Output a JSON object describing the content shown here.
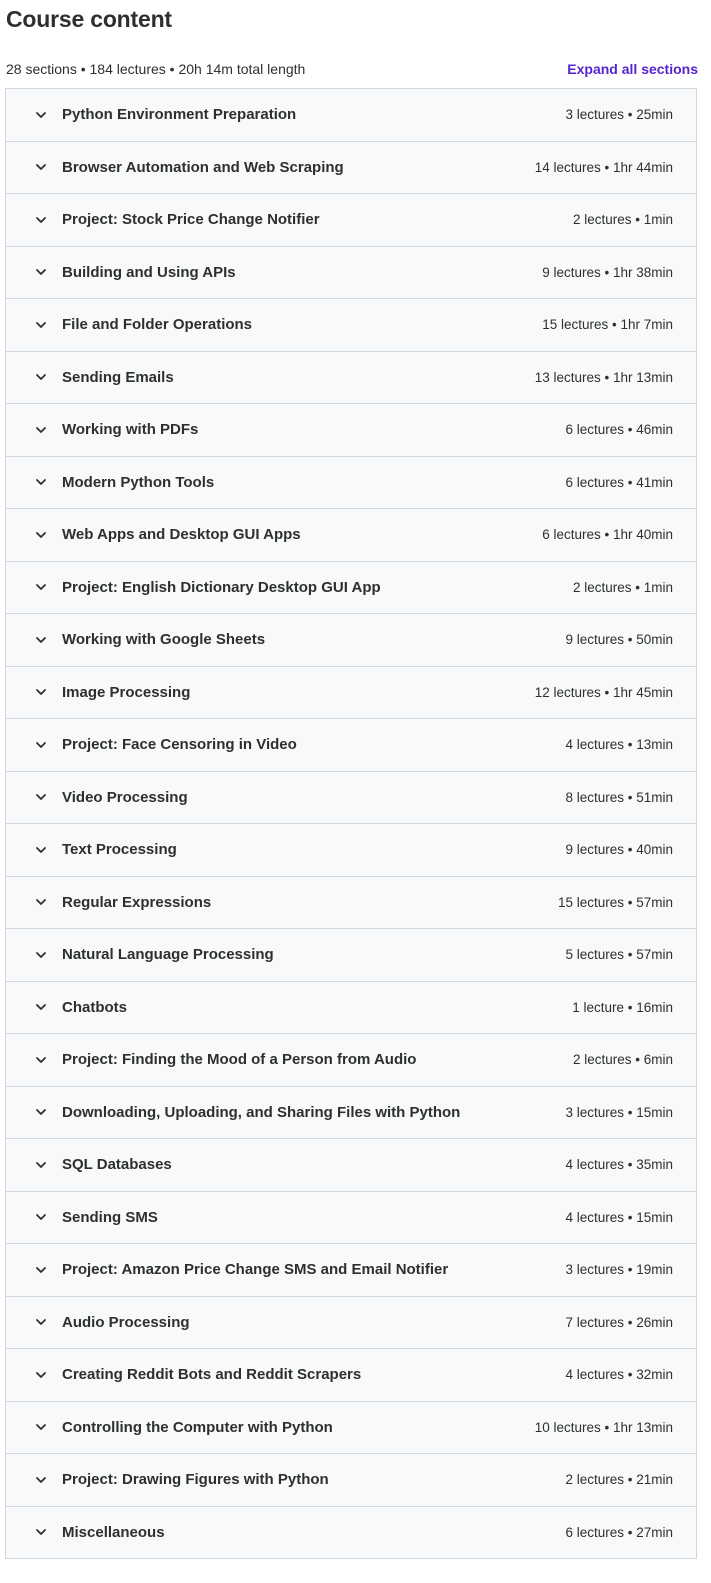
{
  "header": {
    "title": "Course content",
    "summary": "28 sections • 184 lectures • 20h 14m total length",
    "expand_label": "Expand all sections"
  },
  "icons": {
    "section_toggle": "chevron-down-icon"
  },
  "colors": {
    "accent": "#5624d0",
    "section_bg": "#f7f9fa",
    "border": "#d1d7dc",
    "text": "#2d2f31"
  },
  "sections": [
    {
      "title": "Python Environment Preparation",
      "meta": "3 lectures • 25min"
    },
    {
      "title": "Browser Automation and Web Scraping",
      "meta": "14 lectures • 1hr 44min"
    },
    {
      "title": "Project: Stock Price Change Notifier",
      "meta": "2 lectures • 1min"
    },
    {
      "title": "Building and Using APIs",
      "meta": "9 lectures • 1hr 38min"
    },
    {
      "title": "File and Folder Operations",
      "meta": "15 lectures • 1hr 7min"
    },
    {
      "title": "Sending Emails",
      "meta": "13 lectures • 1hr 13min"
    },
    {
      "title": "Working with PDFs",
      "meta": "6 lectures • 46min"
    },
    {
      "title": "Modern Python Tools",
      "meta": "6 lectures • 41min"
    },
    {
      "title": "Web Apps and Desktop GUI Apps",
      "meta": "6 lectures • 1hr 40min"
    },
    {
      "title": "Project: English Dictionary Desktop GUI App",
      "meta": "2 lectures • 1min"
    },
    {
      "title": "Working with Google Sheets",
      "meta": "9 lectures • 50min"
    },
    {
      "title": "Image Processing",
      "meta": "12 lectures • 1hr 45min"
    },
    {
      "title": "Project: Face Censoring in Video",
      "meta": "4 lectures • 13min"
    },
    {
      "title": "Video Processing",
      "meta": "8 lectures • 51min"
    },
    {
      "title": "Text Processing",
      "meta": "9 lectures • 40min"
    },
    {
      "title": "Regular Expressions",
      "meta": "15 lectures • 57min"
    },
    {
      "title": "Natural Language Processing",
      "meta": "5 lectures • 57min"
    },
    {
      "title": "Chatbots",
      "meta": "1 lecture • 16min"
    },
    {
      "title": "Project: Finding the Mood of a Person from Audio",
      "meta": "2 lectures • 6min"
    },
    {
      "title": "Downloading, Uploading, and Sharing Files with Python",
      "meta": "3 lectures • 15min"
    },
    {
      "title": "SQL Databases",
      "meta": "4 lectures • 35min"
    },
    {
      "title": "Sending SMS",
      "meta": "4 lectures • 15min"
    },
    {
      "title": "Project: Amazon Price Change SMS and Email Notifier",
      "meta": "3 lectures • 19min"
    },
    {
      "title": "Audio Processing",
      "meta": "7 lectures • 26min"
    },
    {
      "title": "Creating Reddit Bots and Reddit Scrapers",
      "meta": "4 lectures • 32min"
    },
    {
      "title": "Controlling the Computer with Python",
      "meta": "10 lectures • 1hr 13min"
    },
    {
      "title": "Project: Drawing Figures with Python",
      "meta": "2 lectures • 21min"
    },
    {
      "title": "Miscellaneous",
      "meta": "6 lectures • 27min"
    }
  ]
}
